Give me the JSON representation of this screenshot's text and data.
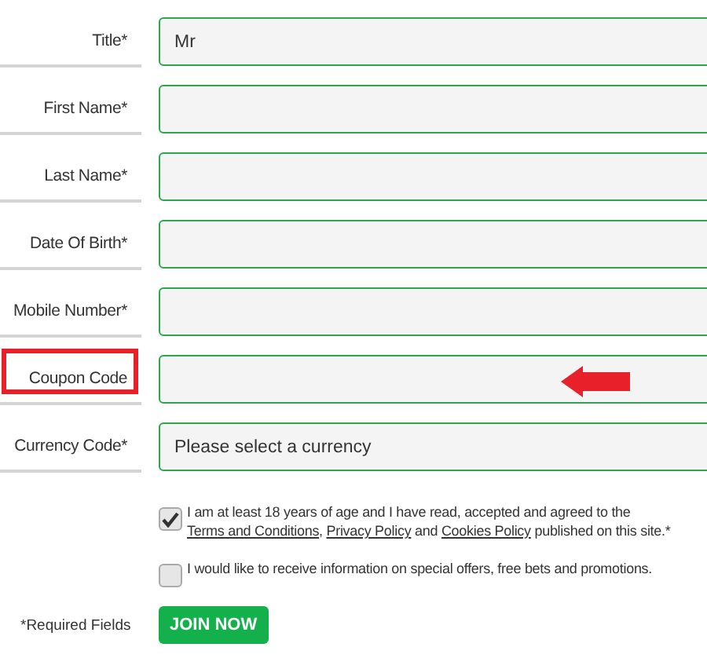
{
  "fields": [
    {
      "label": "Title*",
      "value": "Mr",
      "highlighted": false,
      "arrow": false
    },
    {
      "label": "First Name*",
      "highlighted": false,
      "arrow": false
    },
    {
      "label": "Last Name*",
      "highlighted": false,
      "arrow": false
    },
    {
      "label": "Date Of Birth*",
      "highlighted": false,
      "arrow": false
    },
    {
      "label": "Mobile Number*",
      "highlighted": false,
      "arrow": false
    },
    {
      "label": "Coupon Code",
      "highlighted": true,
      "arrow": true
    },
    {
      "label": "Currency Code*",
      "value": "Please select a currency",
      "highlighted": false,
      "arrow": false
    }
  ],
  "consents": [
    {
      "checked": true,
      "segments": [
        {
          "text": "I am at least 18 years of age and I have read, accepted and agreed to the ",
          "link": false
        },
        {
          "text": "Terms and Conditions",
          "link": true
        },
        {
          "text": ", ",
          "link": false
        },
        {
          "text": "Privacy Policy",
          "link": true
        },
        {
          "text": " and ",
          "link": false
        },
        {
          "text": "Cookies Policy",
          "link": true
        },
        {
          "text": " published on this site.*",
          "link": false
        }
      ]
    },
    {
      "checked": false,
      "segments": [
        {
          "text": "I would like to receive information on special offers, free bets and promotions.",
          "link": false
        }
      ]
    }
  ],
  "footer": {
    "note": "*Required Fields",
    "button": "JOIN NOW"
  }
}
